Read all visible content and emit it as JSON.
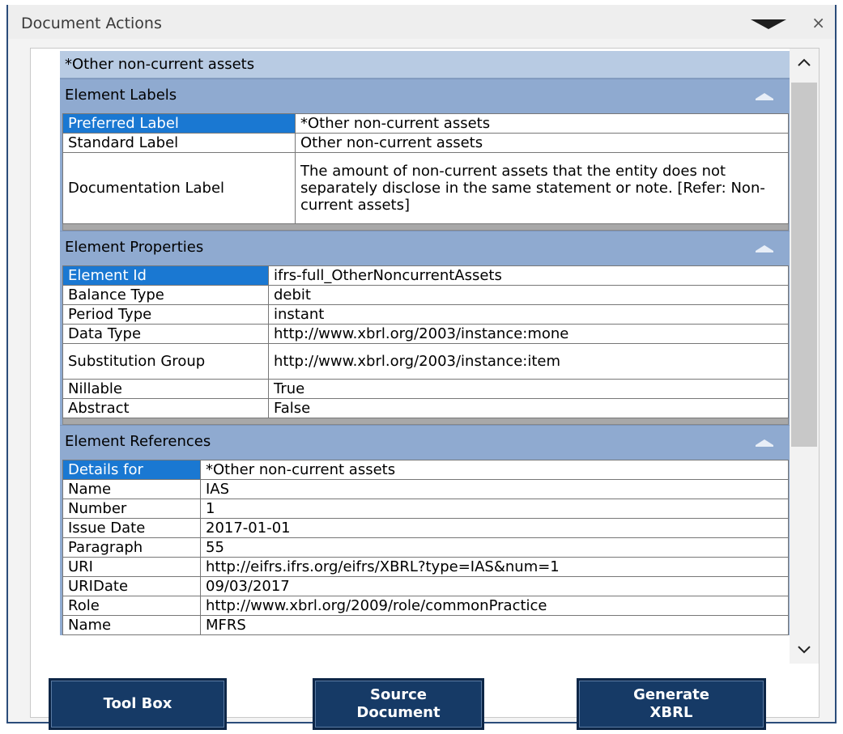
{
  "pane": {
    "title": "Document Actions"
  },
  "element_name": "*Other non-current assets",
  "labels_section": {
    "title": "Element Labels",
    "rows": [
      {
        "key": "Preferred Label",
        "value": "*Other non-current assets"
      },
      {
        "key": "Standard Label",
        "value": "Other non-current assets"
      },
      {
        "key": "Documentation Label",
        "value": "The amount of non-current assets that the entity does not separately disclose in the same statement or note. [Refer: Non-current assets]"
      }
    ]
  },
  "properties_section": {
    "title": "Element Properties",
    "rows": [
      {
        "key": "Element Id",
        "value": "ifrs-full_OtherNoncurrentAssets"
      },
      {
        "key": "Balance Type",
        "value": "debit"
      },
      {
        "key": "Period Type",
        "value": "instant"
      },
      {
        "key": "Data Type",
        "value": "http://www.xbrl.org/2003/instance:mone"
      },
      {
        "key": "Substitution Group",
        "value": "http://www.xbrl.org/2003/instance:item"
      },
      {
        "key": "Nillable",
        "value": "True"
      },
      {
        "key": "Abstract",
        "value": "False"
      }
    ]
  },
  "references_section": {
    "title": "Element References",
    "rows": [
      {
        "key": "Details for",
        "value": "*Other non-current assets"
      },
      {
        "key": "Name",
        "value": "IAS"
      },
      {
        "key": "Number",
        "value": "1"
      },
      {
        "key": "Issue Date",
        "value": "2017-01-01"
      },
      {
        "key": "Paragraph",
        "value": "55"
      },
      {
        "key": "URI",
        "value": "http://eifrs.ifrs.org/eifrs/XBRL?type=IAS&num=1"
      },
      {
        "key": "URIDate",
        "value": "09/03/2017"
      },
      {
        "key": "Role",
        "value": "http://www.xbrl.org/2009/role/commonPractice"
      },
      {
        "key": "Name",
        "value": "MFRS"
      }
    ]
  },
  "buttons": {
    "tool_box": "Tool Box",
    "source_document_1": "Source",
    "source_document_2": "Document",
    "generate_xbrl_1": "Generate",
    "generate_xbrl_2": "XBRL"
  },
  "icons": {
    "dropdown": "chevron-down-icon",
    "close": "close-icon",
    "collapse": "collapse-up-icon"
  }
}
